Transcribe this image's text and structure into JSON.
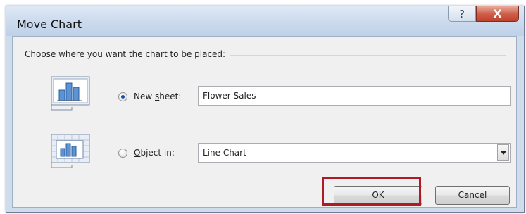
{
  "window": {
    "title": "Move Chart",
    "help_label": "?",
    "close_label": "X"
  },
  "dialog": {
    "prompt": "Choose where you want the chart to be placed:",
    "new_sheet": {
      "label_prefix": "New ",
      "label_accel": "s",
      "label_suffix": "heet:",
      "selected": true,
      "value": "Flower Sales"
    },
    "object_in": {
      "label_accel": "O",
      "label_suffix": "bject in:",
      "selected": false,
      "value": "Line Chart"
    },
    "ok_label": "OK",
    "cancel_label": "Cancel"
  },
  "colors": {
    "highlight_border": "#b01a27",
    "selected_radio": "#1a4f9c"
  }
}
